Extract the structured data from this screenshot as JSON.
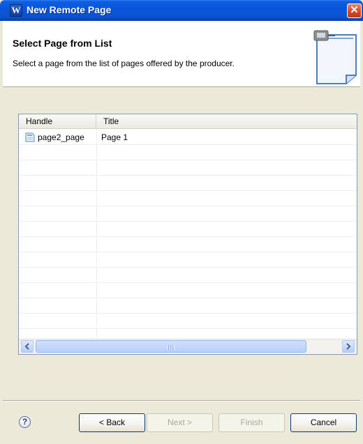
{
  "window": {
    "title": "New Remote Page",
    "close_glyph": "✕"
  },
  "header": {
    "title": "Select Page from List",
    "description": "Select a page from the list of pages offered by the producer."
  },
  "table": {
    "columns": [
      "Handle",
      "Title"
    ],
    "rows": [
      {
        "handle": "page2_page",
        "title": "Page 1",
        "icon": "page-icon"
      }
    ],
    "empty_rows": 13
  },
  "scrollbar": {
    "left_arrow": "◀",
    "right_arrow": "▶"
  },
  "buttons": {
    "help": "?",
    "back": "< Back",
    "next": "Next >",
    "finish": "Finish",
    "cancel": "Cancel"
  },
  "colors": {
    "titlebar": "#0855dd",
    "face": "#ece9d8",
    "accent": "#003c74"
  }
}
